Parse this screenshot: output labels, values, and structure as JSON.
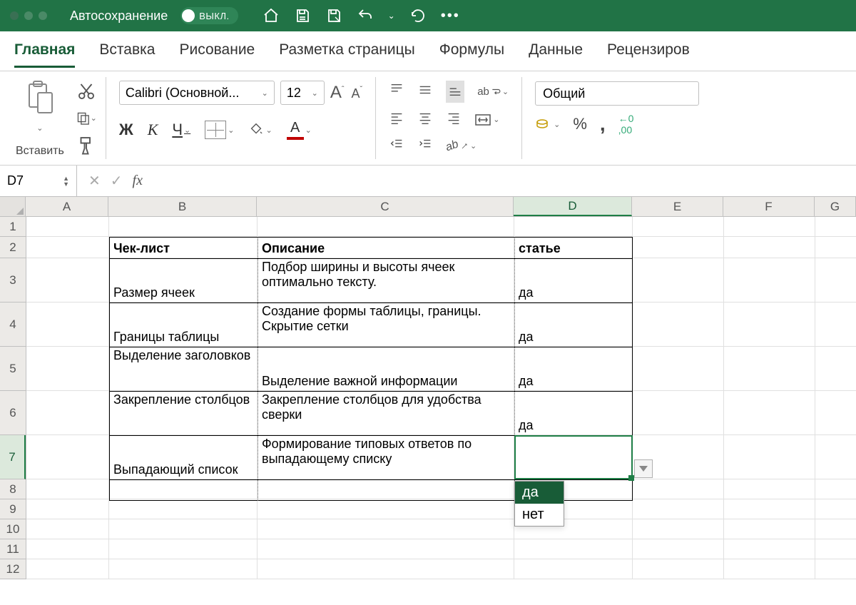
{
  "titleBar": {
    "autosaveLabel": "Автосохранение",
    "autosaveState": "ВЫКЛ."
  },
  "tabs": [
    "Главная",
    "Вставка",
    "Рисование",
    "Разметка страницы",
    "Формулы",
    "Данные",
    "Рецензиров"
  ],
  "activeTab": 0,
  "ribbon": {
    "pasteLabel": "Вставить",
    "fontName": "Calibri (Основной...",
    "fontSize": "12",
    "styles": {
      "bold": "Ж",
      "italic": "К",
      "underline": "Ч"
    },
    "numberFormat": "Общий"
  },
  "nameBox": "D7",
  "formula": "",
  "columns": [
    "A",
    "B",
    "C",
    "D",
    "E",
    "F",
    "G"
  ],
  "rows": [
    "1",
    "2",
    "3",
    "4",
    "5",
    "6",
    "7",
    "8",
    "9",
    "10",
    "11",
    "12"
  ],
  "selectedColumn": "D",
  "selectedRow": "7",
  "table": {
    "headers": {
      "B": "Чек-лист",
      "C": "Описание",
      "D": "Описано в статье"
    },
    "rows": [
      {
        "B": "Размер ячеек",
        "C": "Подбор ширины и высоты ячеек оптимально тексту.",
        "D": "да"
      },
      {
        "B": "Границы таблицы",
        "C": "Создание формы таблицы, границы. Скрытие сетки",
        "D": "да"
      },
      {
        "B": "Выделение заголовков",
        "C": "Выделение важной информации",
        "D": "да"
      },
      {
        "B": "Закрепление столбцов",
        "C": "Закрепление столбцов для удобства сверки",
        "D": "да"
      },
      {
        "B": "Выпадающий список",
        "C": "Формирование типовых ответов по выпадающему списку",
        "D": ""
      }
    ]
  },
  "dropdownOptions": [
    "да",
    "нет"
  ],
  "dropdownHighlighted": 0
}
